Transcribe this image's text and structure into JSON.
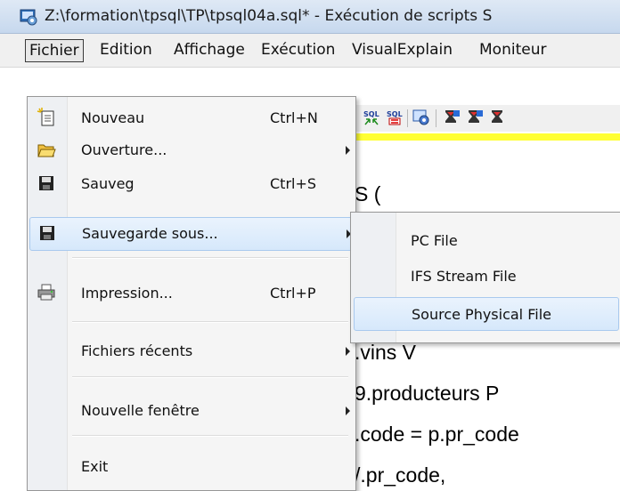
{
  "window": {
    "title": "Z:\\formation\\tpsql\\TP\\tpsql04a.sql* - Exécution de scripts S"
  },
  "menubar": {
    "items": [
      "Fichier",
      "Edition",
      "Affichage",
      "Exécution",
      "VisualExplain",
      "Moniteur"
    ]
  },
  "toolbar": {
    "icons": [
      "sql-run-icon",
      "sql-stop-icon",
      "settings-icon",
      "hourglass-icon",
      "hourglass-icon",
      "hourglass-icon"
    ],
    "highlight_color": "#ffff33"
  },
  "editor": {
    "lines": [
      "S (",
      ".vins V",
      "9.producteurs P",
      ".code = p.pr_code",
      "/.pr_code,"
    ]
  },
  "file_menu": {
    "items": [
      {
        "label": "Nouveau",
        "shortcut": "Ctrl+N",
        "icon": "new-document-icon"
      },
      {
        "label": "Ouverture...",
        "icon": "open-folder-icon"
      },
      {
        "label": "Sauveg",
        "shortcut": "Ctrl+S",
        "icon": "floppy-disk-icon"
      },
      {
        "label": "Sauvegarde sous...",
        "icon": "floppy-disk-icon"
      },
      {
        "label": "Impression...",
        "shortcut": "Ctrl+P",
        "icon": "printer-icon"
      },
      {
        "label": "Fichiers récents"
      },
      {
        "label": "Nouvelle fenêtre"
      },
      {
        "label": "Exit"
      }
    ]
  },
  "save_as_submenu": {
    "items": [
      "PC File",
      "IFS Stream File",
      "Source Physical File"
    ]
  }
}
